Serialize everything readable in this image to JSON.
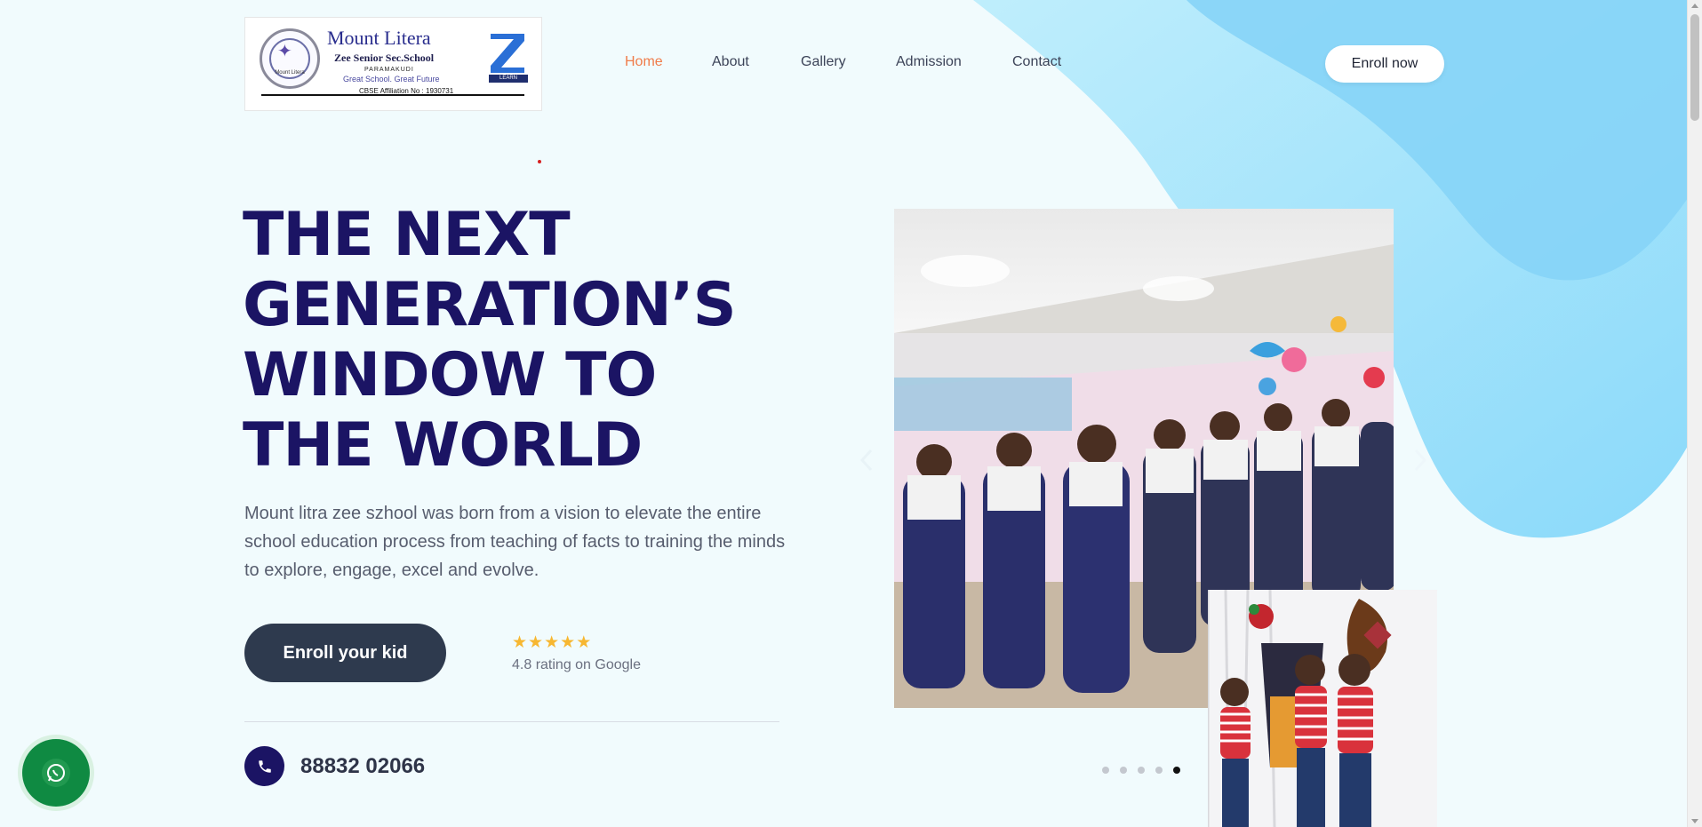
{
  "logo": {
    "title": "Mount Litera",
    "subtitle": "Zee Senior Sec.School",
    "place": "PARAMAKUDI",
    "tagline": "Great School. Great Future",
    "affiliation": "CBSE Affiliation No : 1930731",
    "seal_text": "Mount Litera",
    "z_text": "LEARN"
  },
  "nav": {
    "items": [
      {
        "label": "Home"
      },
      {
        "label": "About"
      },
      {
        "label": "Gallery"
      },
      {
        "label": "Admission"
      },
      {
        "label": "Contact"
      }
    ],
    "active_index": 0,
    "enroll_label": "Enroll now"
  },
  "hero": {
    "title_lines": [
      "THE NEXT",
      "GENERATION’S",
      "WINDOW TO",
      "THE WORLD"
    ],
    "description": "Mount litra zee szhool was born from a vision to elevate the entire school education process from teaching of facts to training the minds to explore, engage, excel and evolve.",
    "cta_label": "Enroll your kid",
    "rating_value": 4.8,
    "rating_text": "4.8 rating on Google",
    "phone": "88832 02066"
  },
  "carousel": {
    "slide_count": 5,
    "active_slide": 4
  },
  "colors": {
    "background": "#f1fbfd",
    "title": "#1b1464",
    "accent": "#f07c4a",
    "button_dark": "#2e3a4e",
    "star": "#f7b731",
    "whatsapp": "#0f8a42",
    "blob": "#a6e3fb"
  },
  "icons": {
    "phone": "phone-icon",
    "whatsapp": "whatsapp-icon",
    "prev": "chevron-left-icon",
    "next": "chevron-right-icon",
    "star": "star-icon"
  }
}
